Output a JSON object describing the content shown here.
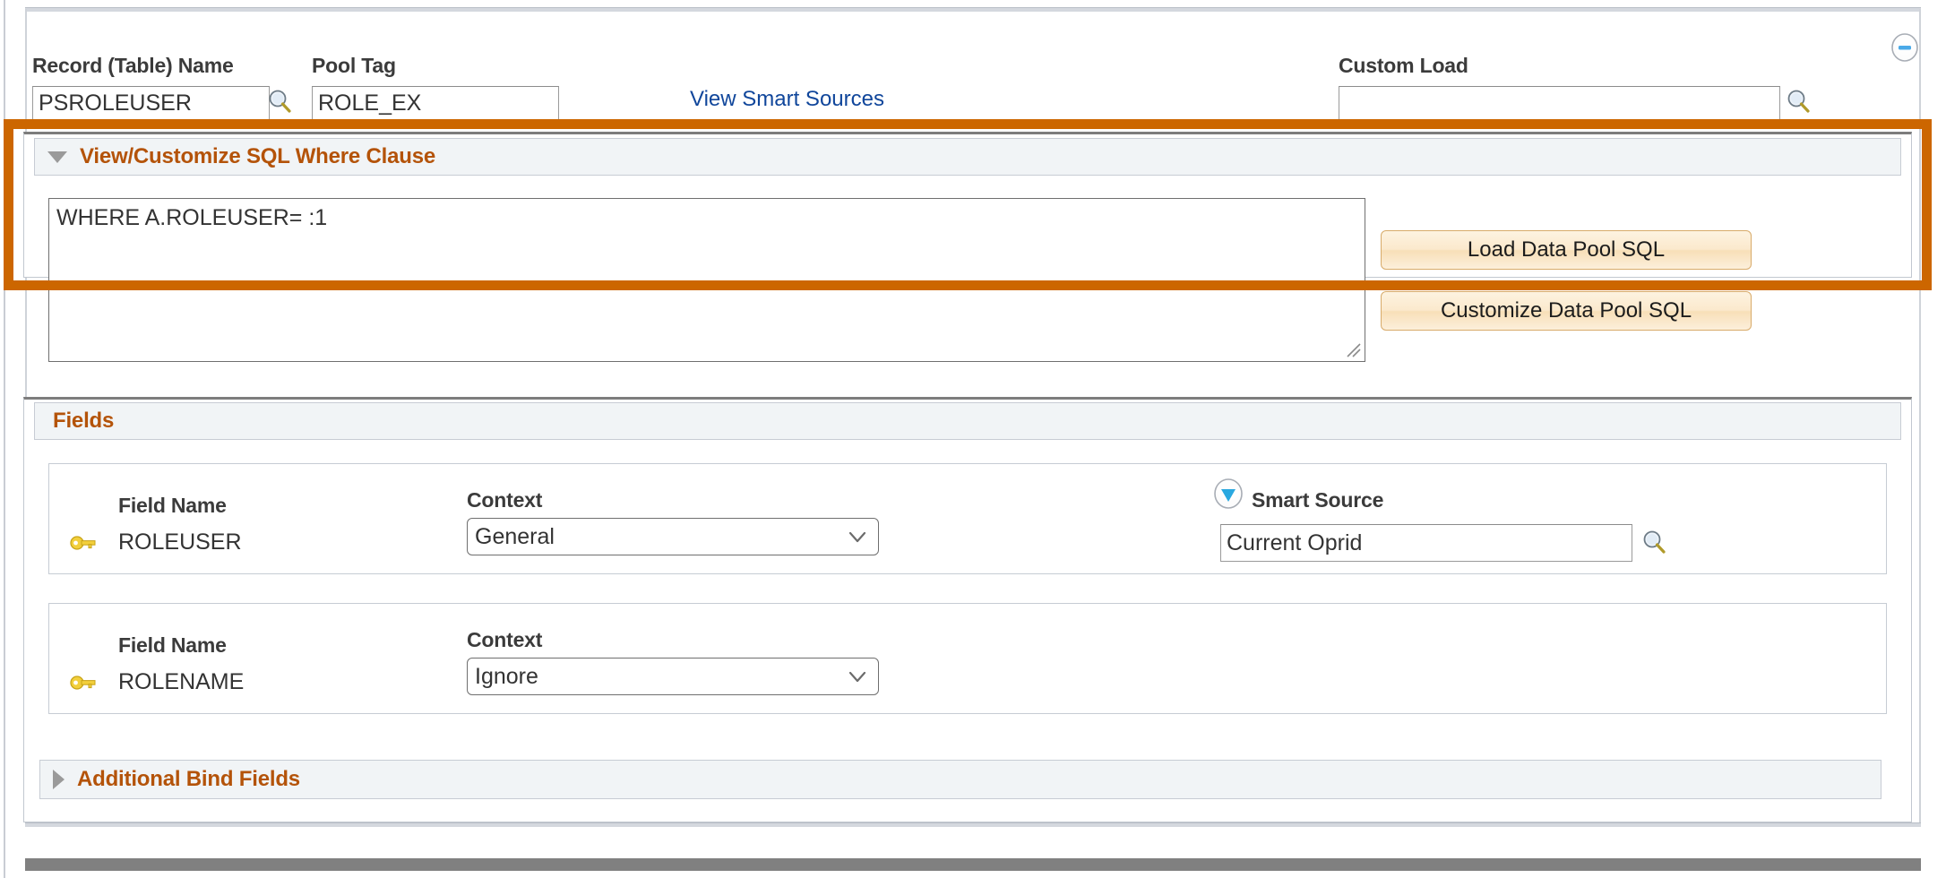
{
  "top": {
    "record_label": "Record (Table) Name",
    "record_value": "PSROLEUSER",
    "pool_tag_label": "Pool Tag",
    "pool_tag_value": "ROLE_EX",
    "view_smart_sources_link": "View Smart Sources",
    "custom_load_label": "Custom Load",
    "custom_load_value": "",
    "custom_load_placeholder": ""
  },
  "sql_section": {
    "title": "View/Customize SQL Where Clause",
    "expanded": true,
    "sql_text": "WHERE A.ROLEUSER= :1",
    "load_button": "Load Data Pool SQL",
    "customize_button": "Customize Data Pool SQL"
  },
  "fields_section": {
    "title": "Fields",
    "expanded": true,
    "rows": [
      {
        "field_name_label": "Field Name",
        "field_name_value": "ROLEUSER",
        "context_label": "Context",
        "context_value": "General",
        "context_options": [
          "General",
          "Ignore"
        ],
        "smart_source_label": "Smart Source",
        "smart_source_value": "Current Oprid",
        "has_smart_source": true
      },
      {
        "field_name_label": "Field Name",
        "field_name_value": "ROLENAME",
        "context_label": "Context",
        "context_value": "Ignore",
        "context_options": [
          "General",
          "Ignore"
        ],
        "smart_source_label": "",
        "smart_source_value": "",
        "has_smart_source": false
      }
    ]
  },
  "bind_section": {
    "title": "Additional Bind Fields",
    "expanded": false
  },
  "colors": {
    "highlight_border": "#cc6600",
    "section_title": "#b45309",
    "link": "#10469b",
    "section_header_bg": "#f1f4f6",
    "button_border": "#d8ab6a",
    "key_icon": "#f2cf3c",
    "blue_icon": "#29a8e0"
  }
}
